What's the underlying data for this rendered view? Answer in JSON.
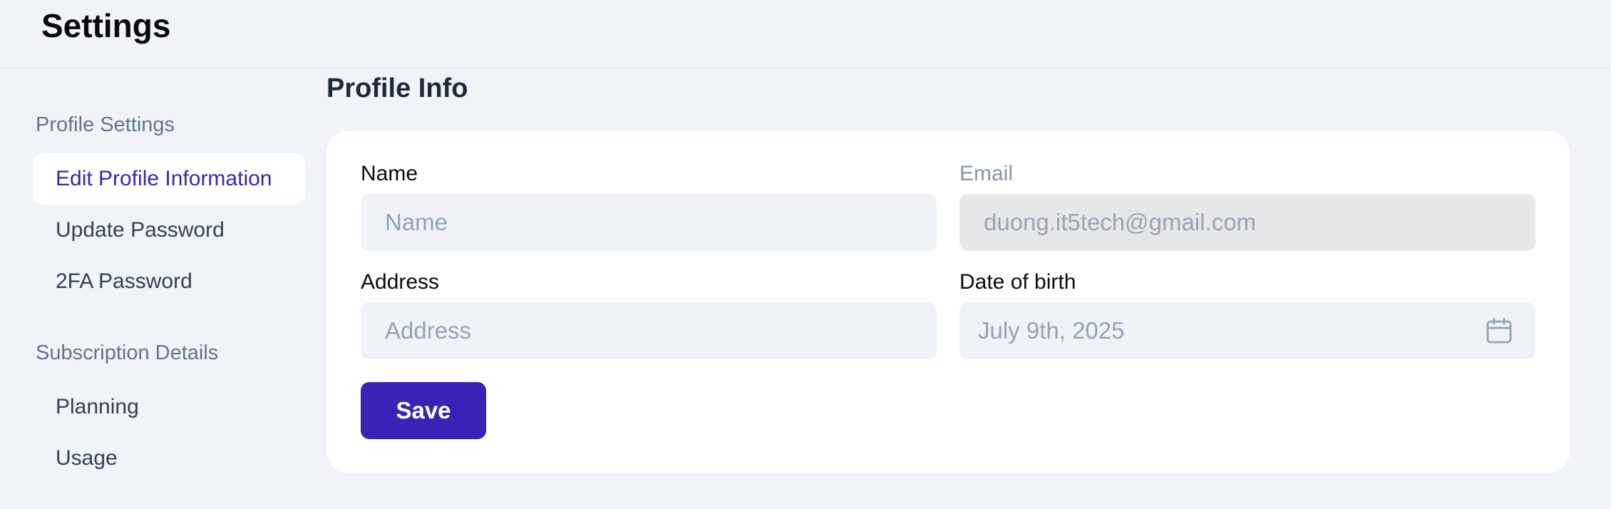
{
  "header": {
    "title": "Settings"
  },
  "sidebar": {
    "sections": [
      {
        "title": "Profile Settings",
        "items": [
          {
            "label": "Edit Profile Information",
            "active": true
          },
          {
            "label": "Update Password",
            "active": false
          },
          {
            "label": "2FA Password",
            "active": false
          }
        ]
      },
      {
        "title": "Subscription Details",
        "items": [
          {
            "label": "Planning",
            "active": false
          },
          {
            "label": "Usage",
            "active": false
          }
        ]
      }
    ]
  },
  "main": {
    "title": "Profile Info",
    "form": {
      "name": {
        "label": "Name",
        "value": "",
        "placeholder": "Name"
      },
      "email": {
        "label": "Email",
        "value": "duong.it5tech@gmail.com",
        "disabled": true
      },
      "address": {
        "label": "Address",
        "value": "",
        "placeholder": "Address"
      },
      "dob": {
        "label": "Date of birth",
        "value": "July 9th, 2025",
        "icon": "calendar-icon"
      },
      "save_label": "Save"
    }
  },
  "colors": {
    "background": "#f0f3f8",
    "card": "#ffffff",
    "accent": "#3b22b7",
    "active_text": "#3b24b9",
    "input_bg": "#eff3f8",
    "disabled_bg": "#e6e7e9"
  }
}
